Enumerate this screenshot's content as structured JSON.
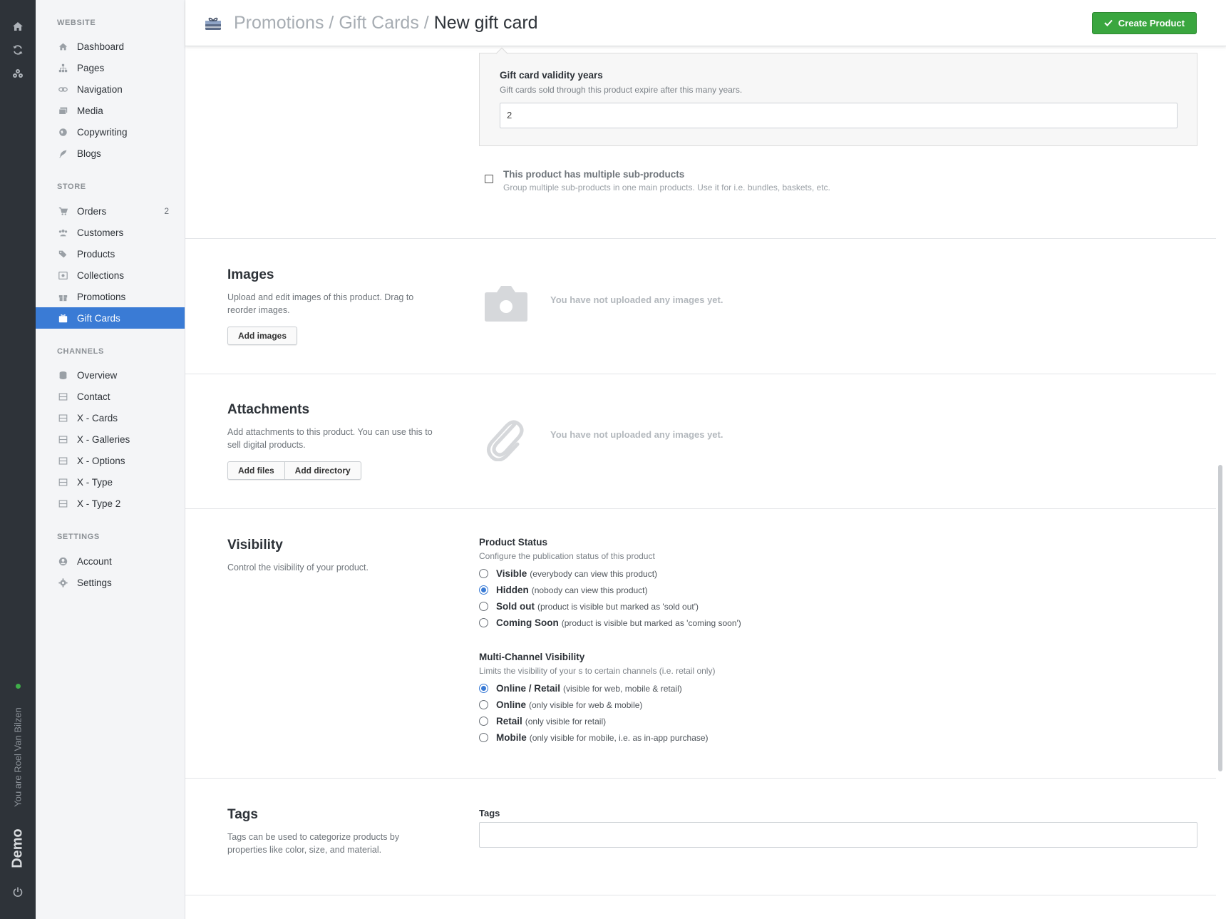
{
  "rail": {
    "icons": [
      "home-icon",
      "refresh-icon",
      "users-cog-icon"
    ],
    "user_text": "You are Roel Van Bilzen",
    "workspace": "Demo",
    "power_icon": "power-icon"
  },
  "sidebar": {
    "sections": [
      {
        "title": "WEBSITE",
        "items": [
          {
            "label": "Dashboard",
            "icon": "home-icon"
          },
          {
            "label": "Pages",
            "icon": "sitemap-icon"
          },
          {
            "label": "Navigation",
            "icon": "link-icon"
          },
          {
            "label": "Media",
            "icon": "images-icon"
          },
          {
            "label": "Copywriting",
            "icon": "globe-icon"
          },
          {
            "label": "Blogs",
            "icon": "feather-icon"
          }
        ]
      },
      {
        "title": "STORE",
        "items": [
          {
            "label": "Orders",
            "icon": "cart-icon",
            "badge": "2"
          },
          {
            "label": "Customers",
            "icon": "users-icon"
          },
          {
            "label": "Products",
            "icon": "tags-icon"
          },
          {
            "label": "Collections",
            "icon": "collection-icon"
          },
          {
            "label": "Promotions",
            "icon": "gift-icon"
          },
          {
            "label": "Gift Cards",
            "icon": "gift-card-icon"
          }
        ]
      },
      {
        "title": "CHANNELS",
        "items": [
          {
            "label": "Overview",
            "icon": "database-icon"
          },
          {
            "label": "Contact",
            "icon": "window-icon"
          },
          {
            "label": "X - Cards",
            "icon": "window-icon"
          },
          {
            "label": "X - Galleries",
            "icon": "window-icon"
          },
          {
            "label": "X - Options",
            "icon": "window-icon"
          },
          {
            "label": "X - Type",
            "icon": "window-icon"
          },
          {
            "label": "X - Type 2",
            "icon": "window-icon"
          }
        ]
      },
      {
        "title": "SETTINGS",
        "items": [
          {
            "label": "Account",
            "icon": "user-circle-icon"
          },
          {
            "label": "Settings",
            "icon": "gear-icon"
          }
        ]
      }
    ],
    "active": "Gift Cards"
  },
  "header": {
    "crumb1": "Promotions",
    "sep1": "/",
    "crumb2": "Gift Cards",
    "sep2": "/",
    "current": "New gift card",
    "create_label": "Create Product",
    "accent": "#3aa63f"
  },
  "validity": {
    "label": "Gift card validity years",
    "hint": "Gift cards sold through this product expire after this many years.",
    "value": "2"
  },
  "subproducts": {
    "label": "This product has multiple sub-products",
    "hint": "Group multiple sub-products in one main products. Use it for i.e. bundles, baskets, etc.",
    "checked": false
  },
  "images": {
    "title": "Images",
    "desc": "Upload and edit images of this product. Drag to reorder images.",
    "button": "Add images",
    "empty": "You have not uploaded any images yet."
  },
  "attachments": {
    "title": "Attachments",
    "desc": "Add attachments to this product. You can use this to sell digital products.",
    "btn_files": "Add files",
    "btn_dir": "Add directory",
    "empty": "You have not uploaded any images yet."
  },
  "visibility": {
    "title": "Visibility",
    "desc": "Control the visibility of your product.",
    "status_label": "Product Status",
    "status_hint": "Configure the publication status of this product",
    "status_options": [
      {
        "label": "Visible",
        "hint": "(everybody can view this product)",
        "checked": false
      },
      {
        "label": "Hidden",
        "hint": "(nobody can view this product)",
        "checked": true
      },
      {
        "label": "Sold out",
        "hint": "(product is visible but marked as 'sold out')",
        "checked": false
      },
      {
        "label": "Coming Soon",
        "hint": "(product is visible but marked as 'coming soon')",
        "checked": false
      }
    ],
    "channel_label": "Multi-Channel Visibility",
    "channel_hint": "Limits the visibility of your s to certain channels (i.e. retail only)",
    "channel_options": [
      {
        "label": "Online / Retail",
        "hint": "(visible for web, mobile & retail)",
        "checked": true
      },
      {
        "label": "Online",
        "hint": "(only visible for web & mobile)",
        "checked": false
      },
      {
        "label": "Retail",
        "hint": "(only visible for retail)",
        "checked": false
      },
      {
        "label": "Mobile",
        "hint": "(only visible for mobile, i.e. as in-app purchase)",
        "checked": false
      }
    ]
  },
  "tags": {
    "title": "Tags",
    "desc": "Tags can be used to categorize products by properties like color, size, and material.",
    "field_label": "Tags",
    "value": ""
  }
}
